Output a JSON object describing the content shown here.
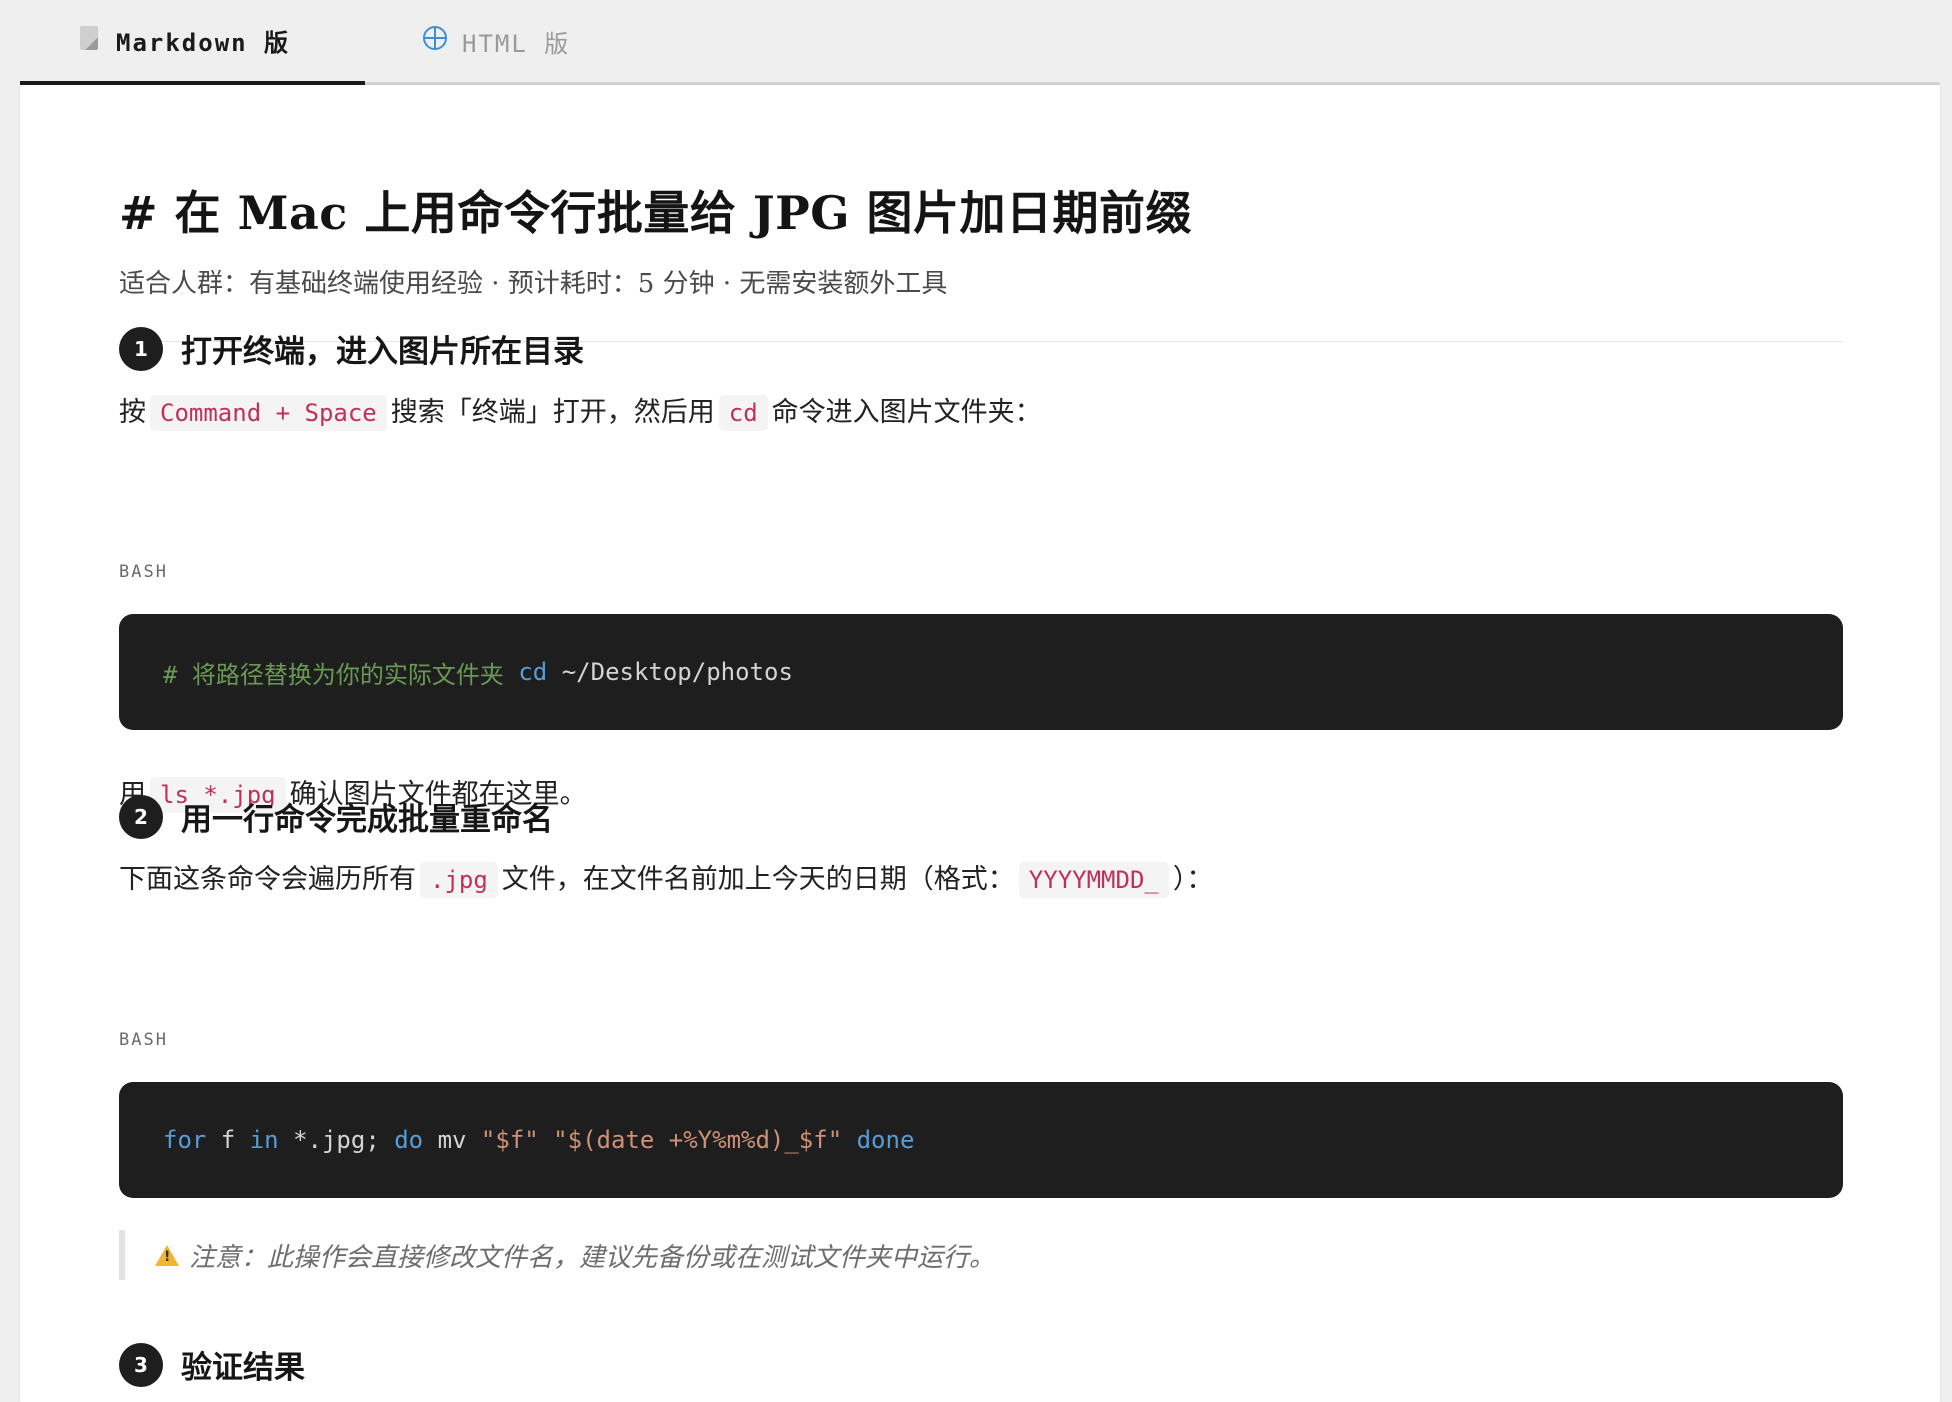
{
  "tabs": [
    {
      "icon": "document-icon",
      "label": "Markdown 版",
      "active": true
    },
    {
      "icon": "globe-icon",
      "label": "HTML 版",
      "active": false
    }
  ],
  "title": "# 在 Mac 上用命令行批量给 JPG 图片加日期前缀",
  "meta": "适合人群：有基础终端使用经验 · 预计耗时：5 分钟 · 无需安装额外工具",
  "steps": [
    {
      "number": "1",
      "title": "打开终端，进入图片所在目录",
      "intro": {
        "t1": "按",
        "code1": "Command + Space",
        "t2": "搜索「终端」打开，然后用",
        "code2": "cd",
        "t3": "命令进入图片文件夹："
      },
      "code_lang": "BASH",
      "code": {
        "comment": "# 将路径替换为你的实际文件夹",
        "kw": "cd",
        "rest": " ~/Desktop/photos"
      },
      "after": {
        "t1": "用",
        "code1": "ls *.jpg",
        "t2": "确认图片文件都在这里。"
      }
    },
    {
      "number": "2",
      "title": "用一行命令完成批量重命名",
      "intro": {
        "t1": "下面这条命令会遍历所有",
        "code1": ".jpg",
        "t2": "文件，在文件名前加上今天的日期（格式：",
        "code2": "YYYYMMDD_",
        "t3": "）："
      },
      "code_lang": "BASH",
      "code": {
        "for": "for",
        "var": " f ",
        "in": "in",
        "glob": " *.jpg; ",
        "do": "do",
        "mv": " mv ",
        "s1": "\"$f\"",
        "sp": " ",
        "s2": "\"$(date +%Y%m%d)_$f\"",
        "sp2": " ",
        "done": "done"
      },
      "note": "注意：此操作会直接修改文件名，建议先备份或在测试文件夹中运行。"
    },
    {
      "number": "3",
      "title": "验证结果"
    }
  ]
}
